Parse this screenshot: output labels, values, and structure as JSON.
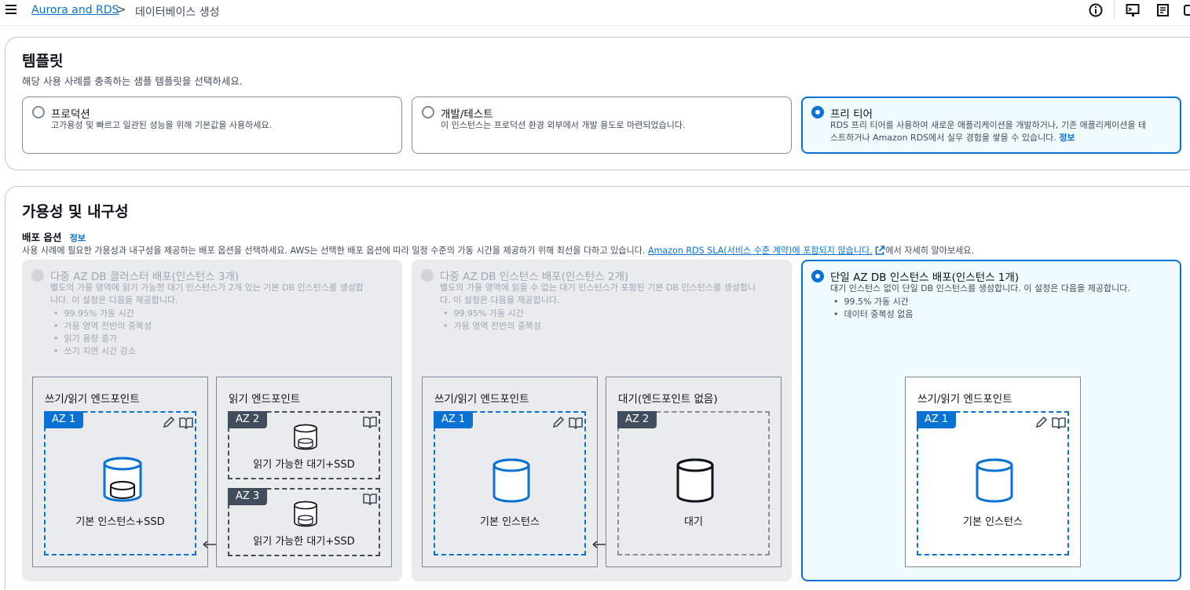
{
  "breadcrumb": {
    "parent": "Aurora and RDS",
    "separator": ">",
    "current": "데이터베이스 생성"
  },
  "topbar_icons": [
    "info-icon",
    "cloudshell-icon",
    "notifications-icon",
    "settings-icon"
  ],
  "template": {
    "title": "템플릿",
    "description": "해당 사용 사례를 충족하는 샘플 템플릿을 선택하세요.",
    "options": [
      {
        "label": "프로덕션",
        "desc": "고가용성 및 빠르고 일관된 성능을 위해 기본값을 사용하세요.",
        "selected": false
      },
      {
        "label": "개발/테스트",
        "desc": "이 인스턴스는 프로덕션 환경 외부에서 개발 용도로 마련되었습니다.",
        "selected": false
      },
      {
        "label": "프리 티어",
        "desc_line1": "RDS 프리 티어를 사용하여 새로운 애플리케이션을 개발하거나, 기존 애플리케이션을 테",
        "desc_line2": "스트하거나 Amazon RDS에서 실무 경험을 쌓을 수 있습니다.",
        "info": "정보",
        "selected": true
      }
    ]
  },
  "availability": {
    "title": "가용성 및 내구성",
    "deploy_label": "배포 옵션",
    "info": "정보",
    "desc_prefix": "사용 사례에 필요한 가용성과 내구성을 제공하는 배포 옵션을 선택하세요. AWS는 선택한 배포 옵션에 따라 일정 수준의 가동 시간을 제공하기 위해 최선을 다하고 있습니다.",
    "desc_link": "Amazon RDS SLA(서비스 수준 계약)에 포함되지 않습니다.",
    "desc_suffix": "에서 자세히 알아보세요.",
    "options": [
      {
        "label": "다중 AZ DB 클러스터 배포(인스턴스 3개)",
        "desc_line1": "별도의 가용 영역에 읽기 가능한 대기 인스턴스가 2개 있는 기본 DB 인스턴스를 생성합",
        "desc_line2": "니다. 이 설정은 다음을 제공합니다.",
        "bullets": [
          "99.95% 가동 시간",
          "가용 영역 전반의 중복성",
          "읽기 용량 증가",
          "쓰기 지연 시간 감소"
        ],
        "disabled": true,
        "diagram": {
          "rw_title": "쓰기/읽기 엔드포인트",
          "ro_title": "읽기 엔드포인트",
          "az1": "AZ 1",
          "az2": "AZ 2",
          "az3": "AZ 3",
          "primary_label": "기본 인스턴스+SSD",
          "standby_label": "읽기 가능한 대기+SSD"
        }
      },
      {
        "label": "다중 AZ DB 인스턴스 배포(인스턴스 2개)",
        "desc_line1": "별도의 가용 영역에 읽을 수 없는 대기 인스턴스가 포함된 기본 DB 인스턴스를 생성합니",
        "desc_line2": "다. 이 설정은 다음을 제공합니다.",
        "bullets": [
          "99.95% 가동 시간",
          "가용 영역 전반의 중복성"
        ],
        "disabled": true,
        "diagram": {
          "rw_title": "쓰기/읽기 엔드포인트",
          "standby_title": "대기(엔드포인트 없음)",
          "az1": "AZ 1",
          "az2": "AZ 2",
          "primary_label": "기본 인스턴스",
          "standby_label": "대기"
        }
      },
      {
        "label": "단일 AZ DB 인스턴스 배포(인스턴스 1개)",
        "desc_line1": "대기 인스턴스 없이 단일 DB 인스턴스를 생성합니다. 이 설정은 다음을 제공합니다.",
        "bullets": [
          "99.5% 가동 시간",
          "데이터 중복성 없음"
        ],
        "selected": true,
        "diagram": {
          "rw_title": "쓰기/읽기 엔드포인트",
          "az1": "AZ 1",
          "primary_label": "기본 인스턴스"
        }
      }
    ]
  },
  "colors": {
    "accent": "#0972d3",
    "selected_bg": "#f0fbff",
    "disabled_bg": "#e9ebed",
    "az_gray": "#414d5c"
  }
}
